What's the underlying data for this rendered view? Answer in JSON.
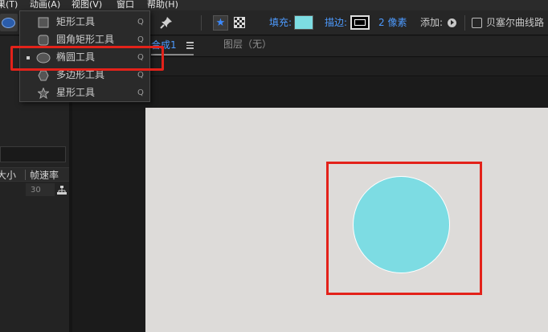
{
  "menubar": {
    "items": [
      {
        "label": "果(T)"
      },
      {
        "label": "动画(A)"
      },
      {
        "label": "视图(V)"
      },
      {
        "label": "窗口"
      },
      {
        "label": "帮助(H)"
      }
    ]
  },
  "toolbar": {
    "fill_label": "填充:",
    "fill_color": "#7ddde3",
    "stroke_label": "描边:",
    "stroke_width": "2 像素",
    "add_label": "添加:",
    "bezier_label": "贝塞尔曲线路"
  },
  "dropdown": {
    "items": [
      {
        "label": "矩形工具",
        "shortcut": "Q",
        "icon": "rectangle-icon",
        "selected": false
      },
      {
        "label": "圆角矩形工具",
        "shortcut": "Q",
        "icon": "rounded-rectangle-icon",
        "selected": false
      },
      {
        "label": "椭圆工具",
        "shortcut": "Q",
        "icon": "ellipse-icon",
        "selected": true
      },
      {
        "label": "多边形工具",
        "shortcut": "Q",
        "icon": "polygon-icon",
        "selected": false
      },
      {
        "label": "星形工具",
        "shortcut": "Q",
        "icon": "star-icon",
        "selected": false
      }
    ]
  },
  "comp": {
    "tab_label": "合成1",
    "layer_label": "图层（无）"
  },
  "left_panel": {
    "col_size": "大小",
    "col_framerate": "帧速率",
    "framerate_value": "30"
  },
  "colors": {
    "accent": "#4d9bff",
    "shape_fill": "#7ddce3",
    "highlight": "#e3221a",
    "canvas": "#dddbd9"
  }
}
